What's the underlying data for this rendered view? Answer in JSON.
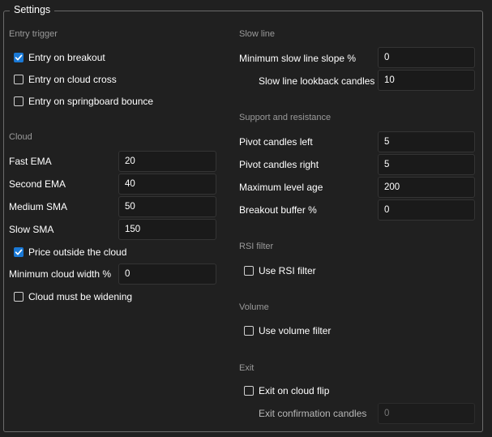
{
  "title": "Settings",
  "left": {
    "entry_trigger": {
      "heading": "Entry trigger",
      "checks": [
        {
          "label": "Entry on breakout",
          "checked": true
        },
        {
          "label": "Entry on cloud cross",
          "checked": false
        },
        {
          "label": "Entry on springboard bounce",
          "checked": false
        }
      ]
    },
    "cloud": {
      "heading": "Cloud",
      "fields": [
        {
          "label": "Fast EMA",
          "value": "20"
        },
        {
          "label": "Second EMA",
          "value": "40"
        },
        {
          "label": "Medium SMA",
          "value": "50"
        },
        {
          "label": "Slow SMA",
          "value": "150"
        }
      ],
      "price_outside": {
        "label": "Price outside the cloud",
        "checked": true
      },
      "min_width": {
        "label": "Minimum cloud width %",
        "value": "0"
      },
      "widening": {
        "label": "Cloud must be widening",
        "checked": false
      }
    }
  },
  "right": {
    "slow_line": {
      "heading": "Slow line",
      "min_slope": {
        "label": "Minimum slow line slope %",
        "value": "0"
      },
      "lookback": {
        "label": "Slow line lookback candles",
        "value": "10"
      }
    },
    "support": {
      "heading": "Support and resistance",
      "fields": [
        {
          "label": "Pivot candles left",
          "value": "5"
        },
        {
          "label": "Pivot candles right",
          "value": "5"
        },
        {
          "label": "Maximum level age",
          "value": "200"
        },
        {
          "label": "Breakout buffer %",
          "value": "0"
        }
      ]
    },
    "rsi": {
      "heading": "RSI filter",
      "check": {
        "label": "Use RSI filter",
        "checked": false
      }
    },
    "volume": {
      "heading": "Volume",
      "check": {
        "label": "Use volume filter",
        "checked": false
      }
    },
    "exit": {
      "heading": "Exit",
      "check": {
        "label": "Exit on cloud flip",
        "checked": false
      },
      "confirm": {
        "label": "Exit confirmation candles",
        "value": "0"
      }
    }
  },
  "colors": {
    "accent": "#1a79d6",
    "background": "#202020",
    "border": "#6b6b6b"
  }
}
